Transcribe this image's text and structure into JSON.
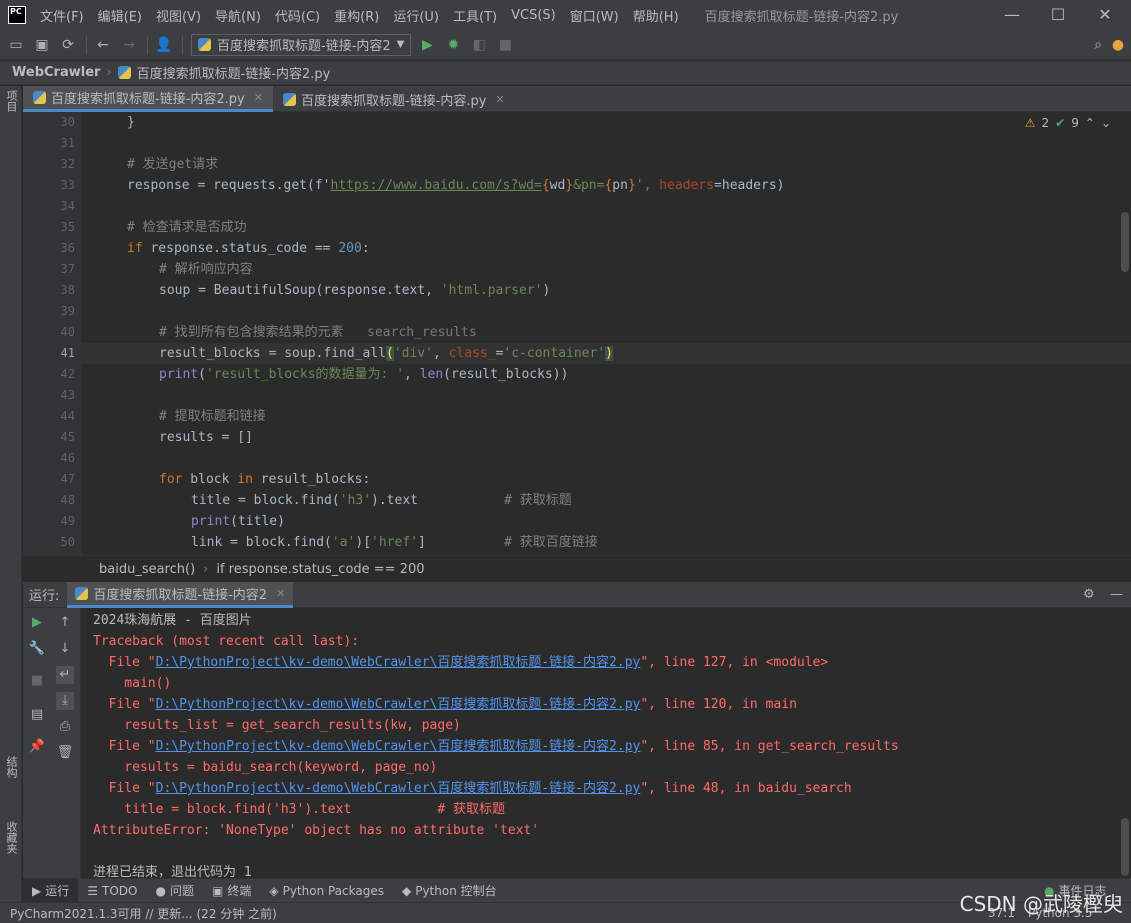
{
  "menu": {
    "items": [
      "文件(F)",
      "编辑(E)",
      "视图(V)",
      "导航(N)",
      "代码(C)",
      "重构(R)",
      "运行(U)",
      "工具(T)",
      "VCS(S)",
      "窗口(W)",
      "帮助(H)"
    ],
    "window_title": "百度搜索抓取标题-链接-内容2.py",
    "logo": "PC"
  },
  "toolbar": {
    "run_config": "百度搜索抓取标题-链接-内容2"
  },
  "navbar": {
    "project": "WebCrawler",
    "file": "百度搜索抓取标题-链接-内容2.py"
  },
  "left_stripe": {
    "project": "项目",
    "structure": "结构",
    "favorites": "收藏夹"
  },
  "tabs": [
    {
      "label": "百度搜索抓取标题-链接-内容2.py",
      "active": true
    },
    {
      "label": "百度搜索抓取标题-链接-内容.py",
      "active": false
    }
  ],
  "inspection": {
    "warnings": "2",
    "weak_warnings": "9"
  },
  "editor": {
    "line_numbers": [
      "30",
      "31",
      "32",
      "33",
      "34",
      "35",
      "36",
      "37",
      "38",
      "39",
      "40",
      "41",
      "42",
      "43",
      "44",
      "45",
      "46",
      "47",
      "48",
      "49",
      "50"
    ],
    "current_line": "41",
    "lines": {
      "l30": "}",
      "l32": "# 发送get请求",
      "l33_a": "response = requests.get(f'",
      "l33_url": "https://www.baidu.com/s?wd=",
      "l33_b": "{",
      "l33_c": "wd",
      "l33_d": "}",
      "l33_e": "&pn=",
      "l33_f": "{",
      "l33_g": "pn",
      "l33_h": "}",
      "l33_i": "', ",
      "l33_j": "headers",
      "l33_k": "=headers)",
      "l35": "# 检查请求是否成功",
      "l36_kw": "if",
      "l36_a": " response.status_code == ",
      "l36_num": "200",
      "l36_b": ":",
      "l37": "# 解析响应内容",
      "l38_a": "soup = BeautifulSoup(response.text, ",
      "l38_str": "'html.parser'",
      "l38_b": ")",
      "l40": "# 找到所有包含搜索结果的元素",
      "l40_hint": "search_results",
      "l41_a": "result_blocks = soup.find_all",
      "l41_p1": "(",
      "l41_str1": "'div'",
      "l41_b": ", ",
      "l41_param": "class_",
      "l41_c": "=",
      "l41_str2": "'c-container'",
      "l41_p2": ")",
      "l42_bi": "print",
      "l42_a": "(",
      "l42_str": "'result_blocks的数据量为: '",
      "l42_b": ", ",
      "l42_bi2": "len",
      "l42_c": "(result_blocks))",
      "l44": "# 提取标题和链接",
      "l45": "results = []",
      "l47_kw": "for",
      "l47_a": " block ",
      "l47_kw2": "in",
      "l47_b": " result_blocks:",
      "l48_a": "title = block.find(",
      "l48_str": "'h3'",
      "l48_b": ").text",
      "l48_cmt": "# 获取标题",
      "l49_bi": "print",
      "l49_a": "(title)",
      "l50_a": "link = block.find(",
      "l50_str1": "'a'",
      "l50_b": ")[",
      "l50_str2": "'href'",
      "l50_c": "]",
      "l50_cmt": "# 获取百度链接"
    }
  },
  "breadcrumbs": {
    "function": "baidu_search()",
    "block": "if response.status_code == 200"
  },
  "run_panel": {
    "label": "运行:",
    "tab": "百度搜索抓取标题-链接-内容2"
  },
  "console": {
    "l1": "2024珠海航展 - 百度图片",
    "l2": "Traceback (most recent call last):",
    "file_prefix": "  File \"",
    "path": "D:\\PythonProject\\kv-demo\\WebCrawler\\百度搜索抓取标题-链接-内容2.py",
    "l3_suffix": "\", line 127, in <module>",
    "l4": "    main()",
    "l5_suffix": "\", line 120, in main",
    "l6": "    results_list = get_search_results(kw, page)",
    "l7_suffix": "\", line 85, in get_search_results",
    "l8": "    results = baidu_search(keyword, page_no)",
    "l9_suffix": "\", line 48, in baidu_search",
    "l10": "    title = block.find('h3').text           # 获取标题",
    "l11": "AttributeError: 'NoneType' object has no attribute 'text'",
    "l13": "进程已结束，退出代码为 1"
  },
  "bottom_tabs": [
    "运行",
    "TODO",
    "问题",
    "终端",
    "Python Packages",
    "Python 控制台"
  ],
  "bottom_right": "事件日志",
  "statusbar": {
    "message": "PyCharm2021.1.3可用 // 更新... (22 分钟 之前)",
    "position": "37:1",
    "interpreter": "Python 3.5"
  },
  "watermark": "CSDN @武陵樫臾"
}
